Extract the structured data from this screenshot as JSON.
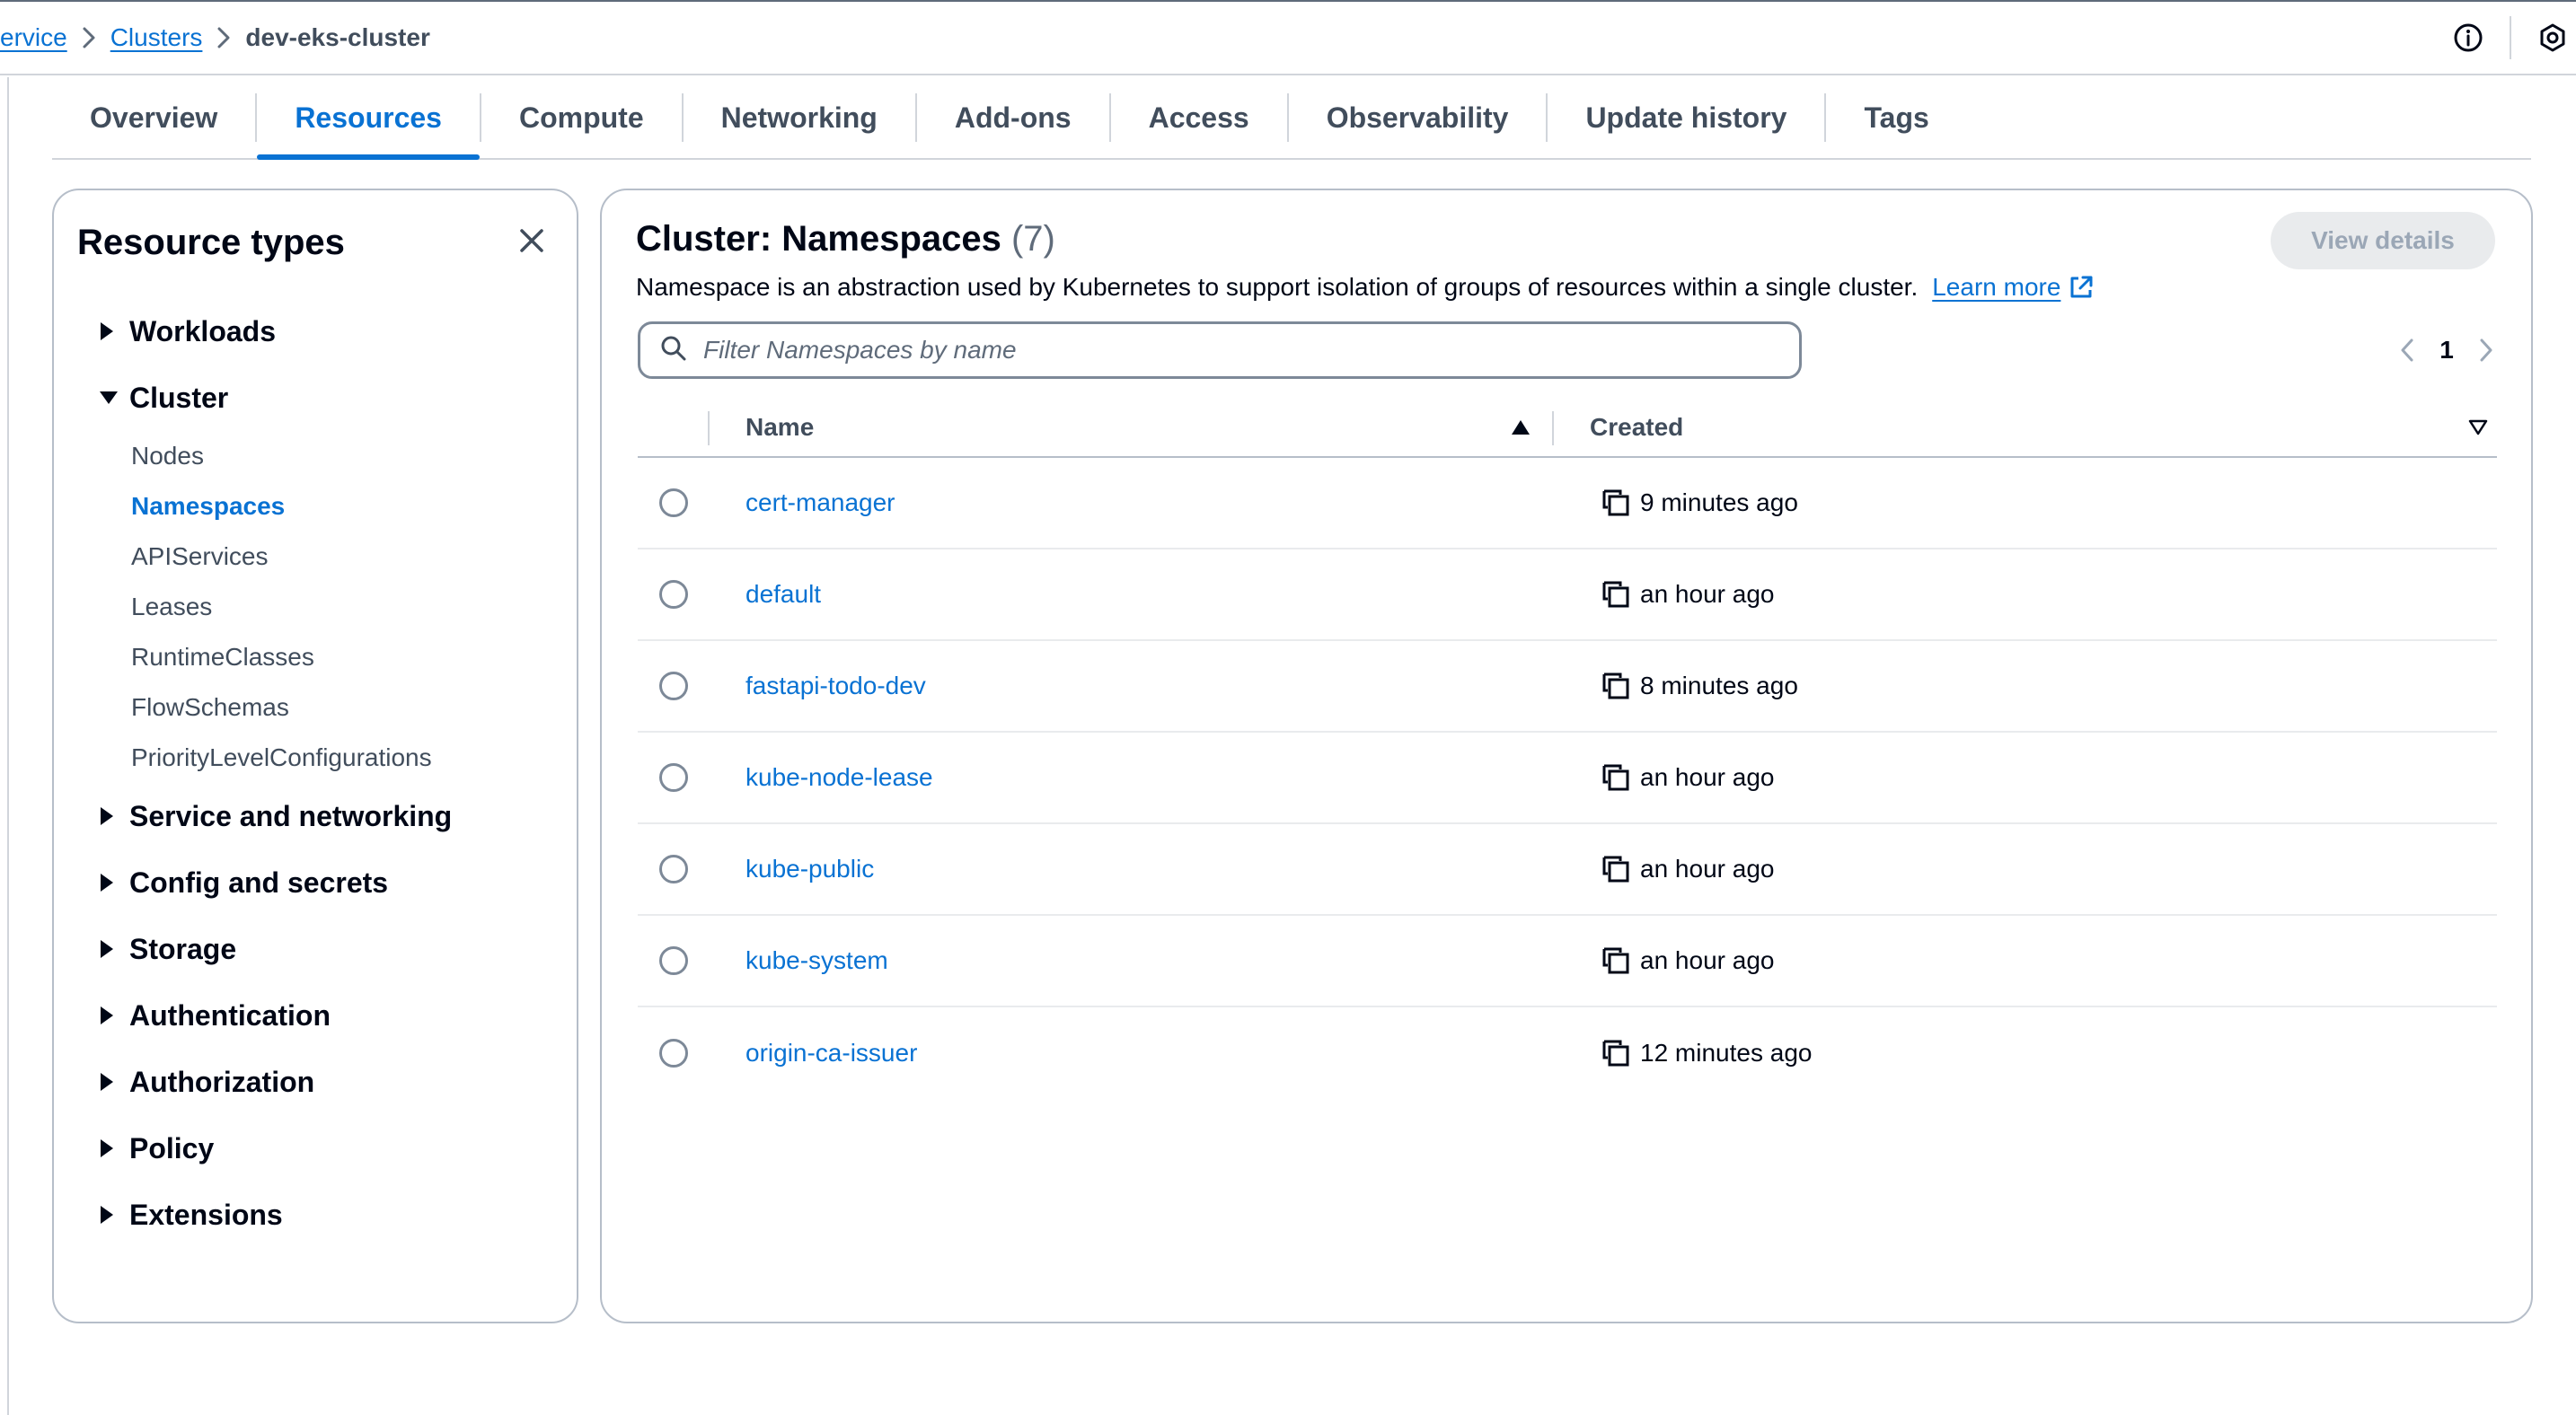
{
  "breadcrumb": {
    "items": [
      "ervice",
      "Clusters"
    ],
    "current": "dev-eks-cluster"
  },
  "topbar": {
    "icons": [
      "info-icon",
      "hexagon-settings-icon"
    ]
  },
  "tabs": [
    {
      "label": "Overview",
      "active": false
    },
    {
      "label": "Resources",
      "active": true
    },
    {
      "label": "Compute",
      "active": false
    },
    {
      "label": "Networking",
      "active": false
    },
    {
      "label": "Add-ons",
      "active": false
    },
    {
      "label": "Access",
      "active": false
    },
    {
      "label": "Observability",
      "active": false
    },
    {
      "label": "Update history",
      "active": false
    },
    {
      "label": "Tags",
      "active": false
    }
  ],
  "sidebar": {
    "title": "Resource types",
    "groups": [
      {
        "label": "Workloads",
        "expanded": false
      },
      {
        "label": "Cluster",
        "expanded": true,
        "children": [
          "Nodes",
          "Namespaces",
          "APIServices",
          "Leases",
          "RuntimeClasses",
          "FlowSchemas",
          "PriorityLevelConfigurations"
        ],
        "active_child": "Namespaces"
      },
      {
        "label": "Service and networking",
        "expanded": false
      },
      {
        "label": "Config and secrets",
        "expanded": false
      },
      {
        "label": "Storage",
        "expanded": false
      },
      {
        "label": "Authentication",
        "expanded": false
      },
      {
        "label": "Authorization",
        "expanded": false
      },
      {
        "label": "Policy",
        "expanded": false
      },
      {
        "label": "Extensions",
        "expanded": false
      }
    ]
  },
  "main": {
    "title": "Cluster: Namespaces",
    "count": "(7)",
    "view_details_label": "View details",
    "description": "Namespace is an abstraction used by Kubernetes to support isolation of groups of resources within a single cluster.",
    "learn_more": "Learn more",
    "filter_placeholder": "Filter Namespaces by name",
    "page": "1",
    "columns": {
      "name": "Name",
      "created": "Created"
    },
    "rows": [
      {
        "name": "cert-manager",
        "created": "9 minutes ago"
      },
      {
        "name": "default",
        "created": "an hour ago"
      },
      {
        "name": "fastapi-todo-dev",
        "created": "8 minutes ago"
      },
      {
        "name": "kube-node-lease",
        "created": "an hour ago"
      },
      {
        "name": "kube-public",
        "created": "an hour ago"
      },
      {
        "name": "kube-system",
        "created": "an hour ago"
      },
      {
        "name": "origin-ca-issuer",
        "created": "12 minutes ago"
      }
    ]
  },
  "colors": {
    "link": "#0972d3",
    "text": "#000716",
    "muted": "#414d5c",
    "border": "#b6bec9",
    "disabled_bg": "#e9ebed"
  }
}
